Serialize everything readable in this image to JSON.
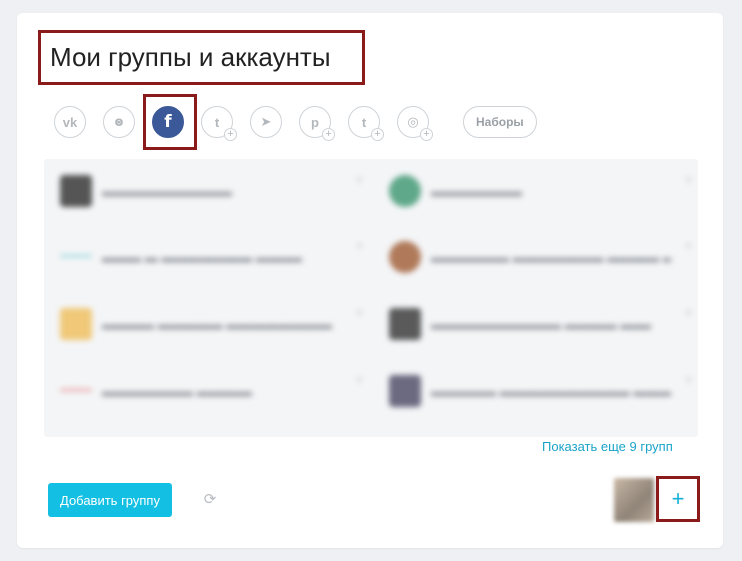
{
  "title": "Мои группы и аккаунты",
  "networks": [
    {
      "name": "vk",
      "glyph": "vk",
      "icon": "vk-icon",
      "has_plus": false
    },
    {
      "name": "ok",
      "glyph": "ꙩ",
      "icon": "odnoklassniki-icon",
      "has_plus": false
    },
    {
      "name": "facebook",
      "glyph": "f",
      "icon": "facebook-icon",
      "has_plus": false,
      "active": true
    },
    {
      "name": "twitter",
      "glyph": "t",
      "icon": "twitter-icon",
      "has_plus": true
    },
    {
      "name": "telegram",
      "glyph": "➤",
      "icon": "telegram-icon",
      "has_plus": false
    },
    {
      "name": "pinterest",
      "glyph": "p",
      "icon": "pinterest-icon",
      "has_plus": true
    },
    {
      "name": "tumblr",
      "glyph": "t",
      "icon": "tumblr-icon",
      "has_plus": true
    },
    {
      "name": "instagram",
      "glyph": "◎",
      "icon": "instagram-icon",
      "has_plus": true
    }
  ],
  "plus_glyph": "+",
  "sets_label": "Наборы",
  "show_more_label": "Показать еще 9 групп",
  "add_group_label": "Добавить группу",
  "refresh_glyph": "⟳",
  "add_account_glyph": "+",
  "colors": {
    "facebook": "#3b5998",
    "accent": "#13c0e3",
    "link": "#1aa3c8",
    "highlight": "#8b1a1a"
  }
}
